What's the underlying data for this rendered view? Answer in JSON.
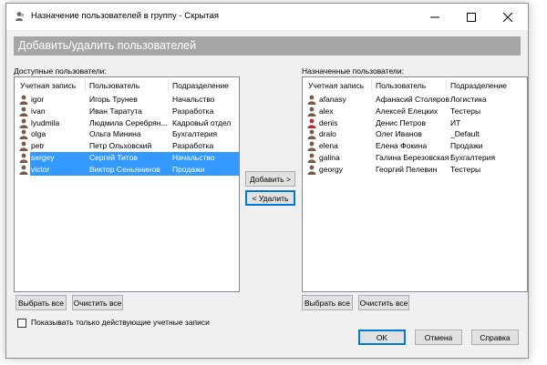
{
  "window": {
    "title": "Назначение пользователей в группу - Скрытая"
  },
  "banner": {
    "title": "Добавить/удалить пользователей"
  },
  "available": {
    "label": "Доступные пользователи:",
    "columns": [
      "Учетная запись",
      "Пользователь",
      "Подразделение"
    ],
    "rows": [
      {
        "account": "igor",
        "user": "Игорь Трунев",
        "dept": "Начальство",
        "selected": false
      },
      {
        "account": "ivan",
        "user": "Иван Таратута",
        "dept": "Разработка",
        "selected": false
      },
      {
        "account": "lyudmila",
        "user": "Людмила Серебрян...",
        "dept": "Кадровый отдел",
        "selected": false
      },
      {
        "account": "olga",
        "user": "Ольга Минина",
        "dept": "Бухгалтерия",
        "selected": false
      },
      {
        "account": "petr",
        "user": "Петр Ольховский",
        "dept": "Разработка",
        "selected": false
      },
      {
        "account": "sergey",
        "user": "Сергей Титов",
        "dept": "Начальство",
        "selected": true
      },
      {
        "account": "victor",
        "user": "Виктор Сеньянинов",
        "dept": "Продажи",
        "selected": true
      }
    ],
    "select_all": "Выбрать все",
    "clear_all": "Очистить все"
  },
  "assigned": {
    "label": "Назначенные пользователи:",
    "columns": [
      "Учетная запись",
      "Пользователь",
      "Подразделение"
    ],
    "rows": [
      {
        "account": "afanasy",
        "user": "Афанасий Столяров",
        "dept": "Логистика",
        "selected": false
      },
      {
        "account": "alex",
        "user": "Алексей Елецких",
        "dept": "Тестеры",
        "selected": false
      },
      {
        "account": "denis",
        "user": "Денис Петров",
        "dept": "ИТ",
        "selected": false
      },
      {
        "account": "dralo",
        "user": "Олег Иванов",
        "dept": "_Default",
        "selected": false
      },
      {
        "account": "elena",
        "user": "Елена Фокина",
        "dept": "Продажи",
        "selected": false
      },
      {
        "account": "galina",
        "user": "Галина Березовская",
        "dept": "Бухгалтерия",
        "selected": false
      },
      {
        "account": "georgy",
        "user": "Георгий Пелевин",
        "dept": "Тестеры",
        "selected": false
      }
    ],
    "select_all": "Выбрать все",
    "clear_all": "Очистить все"
  },
  "actions": {
    "add": "Добавить >",
    "remove": "< Удалить"
  },
  "options": {
    "active_only_label": "Показывать только действующие учетные записи",
    "active_only_checked": false
  },
  "footer": {
    "ok": "OK",
    "cancel": "Отмена",
    "help": "Справка"
  },
  "colors": {
    "selection": "#3399ff",
    "banner": "#a5a5a5",
    "focus_border": "#0078d7"
  }
}
